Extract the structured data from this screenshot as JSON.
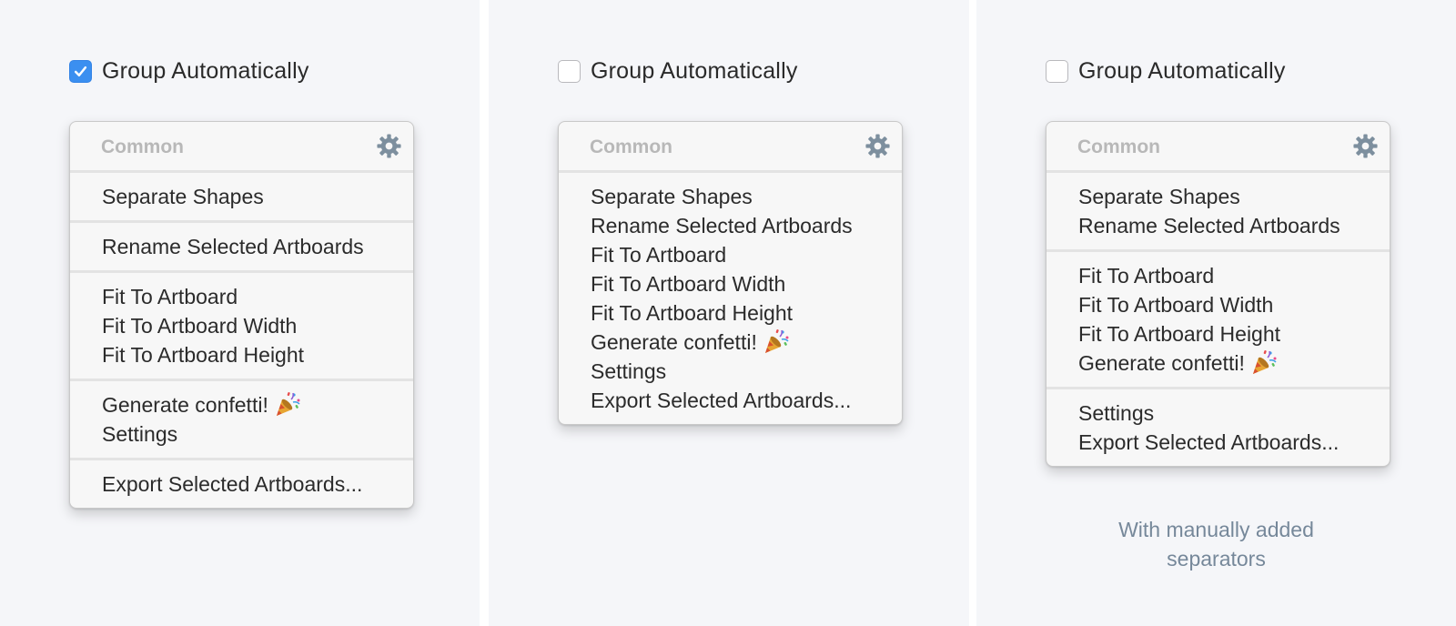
{
  "panels": [
    {
      "checkbox": {
        "label": "Group Automatically",
        "checked": true
      },
      "menu": {
        "header": "Common",
        "groups": [
          [
            "Separate Shapes"
          ],
          [
            "Rename Selected Artboards"
          ],
          [
            "Fit To Artboard",
            "Fit To Artboard Width",
            "Fit To Artboard Height"
          ],
          [
            "Generate confetti!",
            "Settings"
          ],
          [
            "Export Selected Artboards..."
          ]
        ]
      }
    },
    {
      "checkbox": {
        "label": "Group Automatically",
        "checked": false
      },
      "menu": {
        "header": "Common",
        "groups": [
          [
            "Separate Shapes",
            "Rename Selected Artboards",
            "Fit To Artboard",
            "Fit To Artboard Width",
            "Fit To Artboard Height",
            "Generate confetti!",
            "Settings",
            "Export Selected Artboards..."
          ]
        ]
      }
    },
    {
      "checkbox": {
        "label": "Group Automatically",
        "checked": false
      },
      "menu": {
        "header": "Common",
        "groups": [
          [
            "Separate Shapes",
            "Rename Selected Artboards"
          ],
          [
            "Fit To Artboard",
            "Fit To Artboard Width",
            "Fit To Artboard Height",
            "Generate confetti!"
          ],
          [
            "Settings",
            "Export Selected Artboards..."
          ]
        ]
      },
      "caption": [
        "With manually added",
        "separators"
      ]
    }
  ],
  "confetti_item": "Generate confetti!",
  "icons": {
    "settings": "gear-icon",
    "confetti": "party-popper-icon",
    "check": "checkmark-icon"
  },
  "colors": {
    "checkbox_accent": "#3b8ff0",
    "gear": "#7d8f9e",
    "caption": "#76889a"
  }
}
